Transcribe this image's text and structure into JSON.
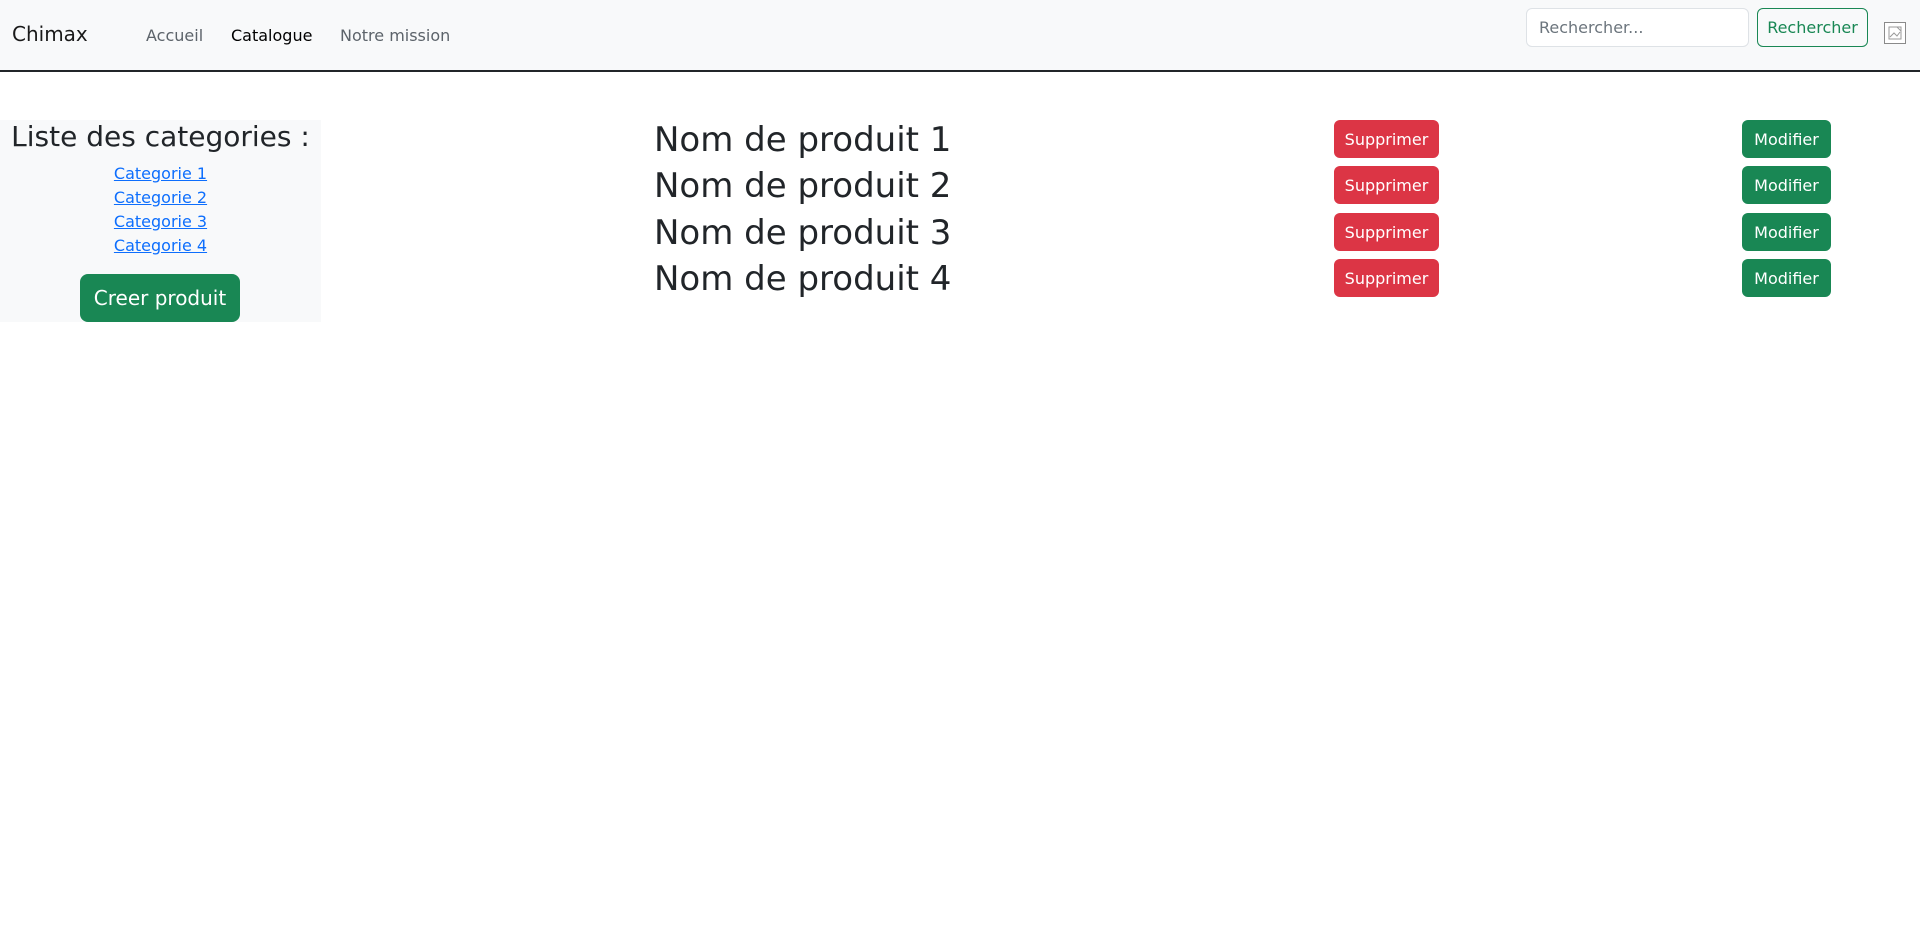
{
  "navbar": {
    "brand": "Chimax",
    "links": [
      {
        "label": "Accueil",
        "active": false
      },
      {
        "label": "Catalogue",
        "active": true
      },
      {
        "label": "Notre mission",
        "active": false
      }
    ],
    "search": {
      "placeholder": "Rechercher...",
      "value": "",
      "button_label": "Rechercher"
    },
    "image_icon": "broken-image-icon"
  },
  "sidebar": {
    "title": "Liste des categories :",
    "categories": [
      "Categorie 1",
      "Categorie 2",
      "Categorie 3",
      "Categorie 4"
    ],
    "create_label": "Creer produit"
  },
  "products": [
    {
      "name": "Nom de produit 1",
      "delete_label": "Supprimer",
      "edit_label": "Modifier"
    },
    {
      "name": "Nom de produit 2",
      "delete_label": "Supprimer",
      "edit_label": "Modifier"
    },
    {
      "name": "Nom de produit 3",
      "delete_label": "Supprimer",
      "edit_label": "Modifier"
    },
    {
      "name": "Nom de produit 4",
      "delete_label": "Supprimer",
      "edit_label": "Modifier"
    }
  ],
  "colors": {
    "navbar_bg": "#f8f9fa",
    "primary_link": "#0d6efd",
    "success": "#198754",
    "danger": "#dc3545",
    "text": "#212529"
  }
}
